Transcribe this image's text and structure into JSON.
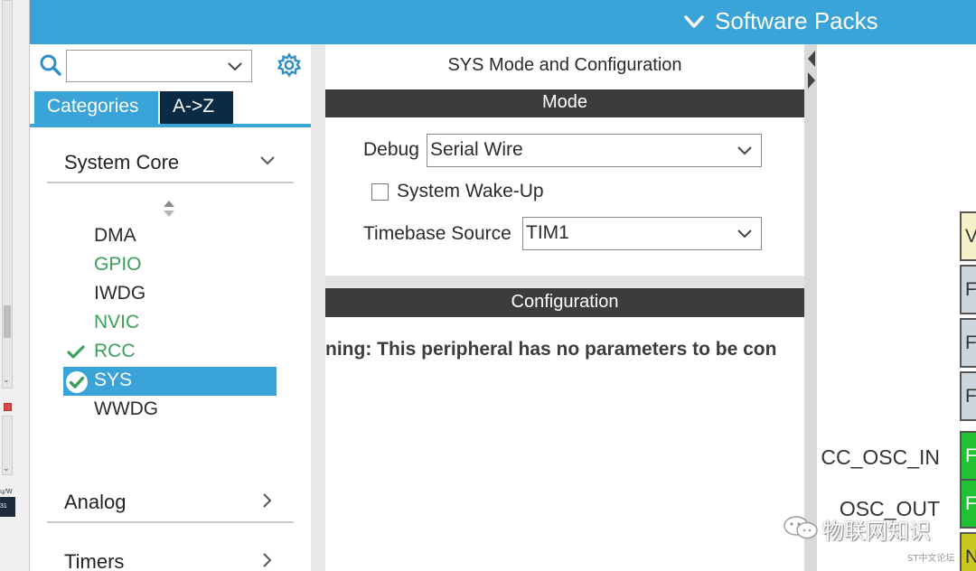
{
  "header": {
    "software_packs": "Software Packs"
  },
  "left_strip": {
    "label_a": "ɥ/W",
    "label_b": "31"
  },
  "sidebar": {
    "search": {
      "value": "",
      "placeholder": ""
    },
    "tabs": [
      {
        "label": "Categories",
        "active": true
      },
      {
        "label": "A->Z",
        "active": false
      }
    ],
    "categories": {
      "system_core": "System Core",
      "analog": "Analog",
      "timers": "Timers"
    },
    "peripherals": [
      {
        "label": "DMA",
        "state": "normal"
      },
      {
        "label": "GPIO",
        "state": "green"
      },
      {
        "label": "IWDG",
        "state": "normal"
      },
      {
        "label": "NVIC",
        "state": "green"
      },
      {
        "label": "RCC",
        "state": "checked"
      },
      {
        "label": "SYS",
        "state": "selected"
      },
      {
        "label": "WWDG",
        "state": "normal"
      }
    ]
  },
  "config": {
    "title": "SYS Mode and Configuration",
    "mode_header": "Mode",
    "debug_label": "Debug",
    "debug_value": "Serial Wire",
    "wakeup_label": "System Wake-Up",
    "wakeup_checked": false,
    "timebase_label": "Timebase Source",
    "timebase_value": "TIM1",
    "config_header": "Configuration",
    "warning": "ning: This peripheral has no parameters to be con"
  },
  "chip": {
    "pin_labels": {
      "osc_in": "CC_OSC_IN",
      "osc_out": "OSC_OUT"
    },
    "pins": [
      {
        "text": "V",
        "color": "#f7f1c9"
      },
      {
        "text": "F",
        "color": "#cdd6de"
      },
      {
        "text": "F",
        "color": "#cdd6de"
      },
      {
        "text": "F",
        "color": "#cdd6de"
      },
      {
        "text": "F",
        "color": "#21c233"
      },
      {
        "text": "F",
        "color": "#21c233"
      },
      {
        "text": "N",
        "color": "#c8c81e"
      }
    ]
  },
  "watermark": {
    "text": "物联网知识",
    "small": "ST中文论坛"
  },
  "colors": {
    "accent": "#3aa3d8",
    "dark_tab": "#0a2a46",
    "section_bar": "#3c3c3c",
    "ok_green": "#3aa05a"
  }
}
